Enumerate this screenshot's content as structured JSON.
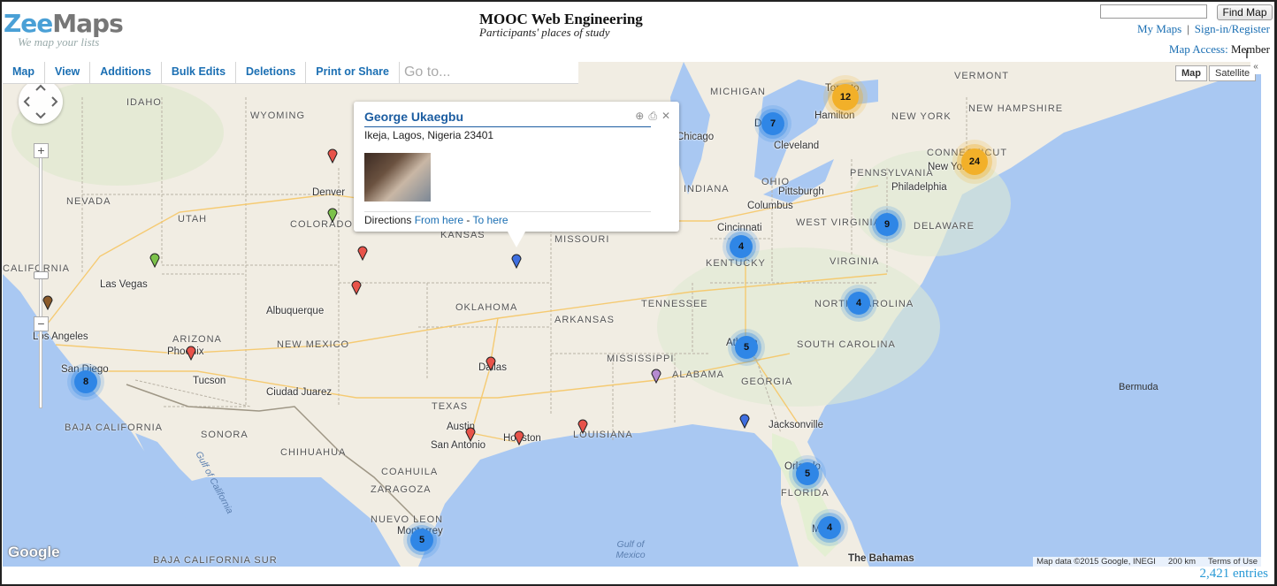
{
  "header": {
    "logo_zee": "Zee",
    "logo_maps": "Maps",
    "tagline": "We map your lists",
    "title": "MOOC Web Engineering",
    "subtitle": "Participants' places of study",
    "find_button": "Find Map",
    "my_maps": "My Maps",
    "separator": "|",
    "signin": "Sign-in/Register",
    "access_label": "Map Access:",
    "access_value": "Member"
  },
  "toolbar": {
    "items": [
      "Map",
      "View",
      "Additions",
      "Bulk Edits",
      "Deletions",
      "Print or Share"
    ],
    "goto_placeholder": "Go to..."
  },
  "map_controls": {
    "zoom_in": "+",
    "zoom_out": "−",
    "type_map": "Map",
    "type_satellite": "Satellite",
    "collapse": "«",
    "google": "Google",
    "attribution": "Map data ©2015 Google, INEGI",
    "scale": "200 km",
    "terms": "Terms of Use"
  },
  "popup": {
    "name": "George Ukaegbu",
    "address": "Ikeja, Lagos, Nigeria 23401",
    "directions_label": "Directions",
    "from_here": "From here",
    "dash": "-",
    "to_here": "To here"
  },
  "states": [
    "IDAHO",
    "WYOMING",
    "NEVADA",
    "UTAH",
    "COLORADO",
    "KANSAS",
    "MISSOURI",
    "CALIFORNIA",
    "OKLAHOMA",
    "ARKANSAS",
    "TENNESSEE",
    "NEW MEXICO",
    "ARIZONA",
    "TEXAS",
    "MISSISSIPPI",
    "ALABAMA",
    "GEORGIA",
    "LOUISIANA",
    "SOUTH CAROLINA",
    "NORTH CAROLINA",
    "KENTUCKY",
    "VIRGINIA",
    "WEST VIRGINIA",
    "OHIO",
    "INDIANA",
    "PENNSYLVANIA",
    "NEW YORK",
    "MICHIGAN",
    "VERMONT",
    "NEW HAMPSHIRE",
    "CONNECTICUT",
    "DELAWARE",
    "FLORIDA",
    "BAJA CALIFORNIA",
    "SONORA",
    "CHIHUAHUA",
    "COAHUILA",
    "NUEVO LEON",
    "ZARAGOZA",
    "BAJA CALIFORNIA SUR"
  ],
  "cities": [
    "Denver",
    "Las Vegas",
    "Albuquerque",
    "Los Angeles",
    "San Diego",
    "Phoenix",
    "Tucson",
    "Ciudad Juarez",
    "Dallas",
    "Austin",
    "San Antonio",
    "Houston",
    "Atlanta",
    "Jacksonville",
    "Orlando",
    "Miami",
    "Cincinnati",
    "Columbus",
    "Cleveland",
    "Pittsburgh",
    "Detroit",
    "Hamilton",
    "Toronto",
    "Philadelphia",
    "New York",
    "Chicago",
    "Monterrey"
  ],
  "water": [
    "Gulf of California",
    "Gulf of Mexico",
    "Bermuda",
    "The Bahamas"
  ],
  "clusters": [
    {
      "label": "12",
      "color": "orange"
    },
    {
      "label": "24",
      "color": "orange"
    },
    {
      "label": "7",
      "color": "blue"
    },
    {
      "label": "9",
      "color": "blue"
    },
    {
      "label": "4",
      "color": "blue"
    },
    {
      "label": "4",
      "color": "blue"
    },
    {
      "label": "5",
      "color": "blue"
    },
    {
      "label": "8",
      "color": "blue"
    },
    {
      "label": "5",
      "color": "blue"
    },
    {
      "label": "4",
      "color": "blue"
    },
    {
      "label": "5",
      "color": "blue"
    }
  ],
  "colors": {
    "cluster_blue": "#2f86e6",
    "cluster_orange": "#f2b029",
    "pin_red": "#e8534a",
    "pin_green": "#7cc24a",
    "pin_blue": "#3f6fe0",
    "pin_brown": "#8a5a2a",
    "pin_violet": "#b58ad0",
    "link": "#1b6fb3"
  },
  "footer": {
    "entries": "2,421 entries"
  }
}
